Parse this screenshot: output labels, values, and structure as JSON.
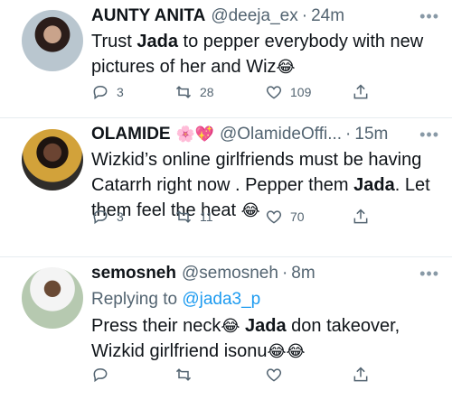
{
  "tweets": [
    {
      "name": "AUNTY ANITA",
      "name_emojis": "",
      "handle": "@deeja_ex",
      "time": "24m",
      "body_parts": [
        "Trust ",
        "Jada",
        " to pepper everybody with new pictures of her and Wiz",
        "😂"
      ],
      "replying_to": "",
      "counts": {
        "replies": "3",
        "retweets": "28",
        "likes": "109"
      }
    },
    {
      "name": "OLAMIDE",
      "name_emojis": "🌸💖",
      "handle": "@OlamideOffi...",
      "time": "15m",
      "body_parts": [
        "Wizkid’s online girlfriends must be having Catarrh right now . Pepper them ",
        "Jada",
        ". Let them feel the heat ",
        "😂"
      ],
      "replying_to": "",
      "counts": {
        "replies": "3",
        "retweets": "11",
        "likes": "70"
      }
    },
    {
      "name": "semosneh",
      "name_emojis": "",
      "handle": "@semosneh",
      "time": "8m",
      "replying_label": "Replying to",
      "replying_to": "@jada3_p",
      "body_parts": [
        "Press their neck",
        "😂",
        " ",
        "Jada",
        " don takeover, Wizkid girlfriend isonu",
        "😂😂"
      ],
      "counts": {
        "replies": "",
        "retweets": "",
        "likes": ""
      }
    }
  ],
  "more_icon": "more-horizontal-icon",
  "dot": "·",
  "colors": {
    "secondary": "#536471",
    "link": "#1d9bf0",
    "divider": "#e6ecf0"
  }
}
